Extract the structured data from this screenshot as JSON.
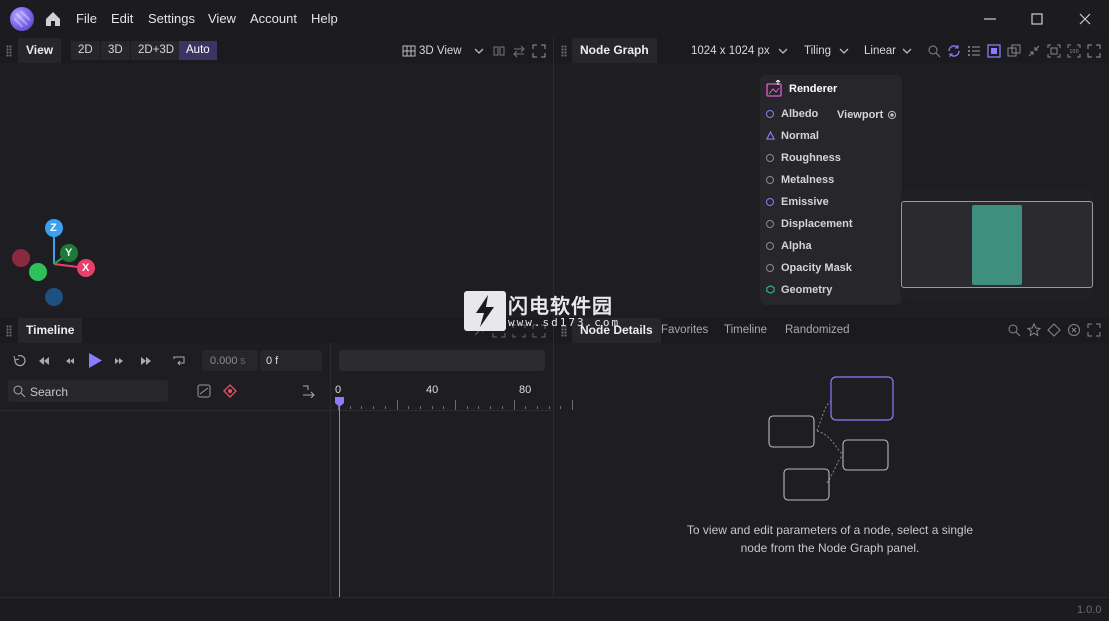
{
  "menu": {
    "items": [
      "File",
      "Edit",
      "Settings",
      "View",
      "Account",
      "Help"
    ]
  },
  "view_panel": {
    "tab": "View",
    "modes": [
      "2D",
      "3D",
      "2D+3D",
      "Auto"
    ],
    "active_mode": "Auto",
    "view_select": "3D View",
    "axes": {
      "x": "X",
      "y": "Y",
      "z": "Z"
    }
  },
  "node_graph": {
    "tab": "Node Graph",
    "resolution": "1024 x 1024 px",
    "tiling": "Tiling",
    "interp": "Linear",
    "node": {
      "title": "Renderer",
      "viewport_label": "Viewport",
      "inputs": [
        "Albedo",
        "Normal",
        "Roughness",
        "Metalness",
        "Emissive",
        "Displacement",
        "Alpha",
        "Opacity Mask",
        "Geometry"
      ]
    }
  },
  "timeline": {
    "tab": "Timeline",
    "time_value": "0.000",
    "time_unit": "s",
    "frame_value": "0 f",
    "search_placeholder": "Search",
    "ruler": [
      "0",
      "40",
      "80"
    ]
  },
  "details": {
    "tabs": [
      "Node Details",
      "Favorites",
      "Timeline",
      "Randomized"
    ],
    "active_tab": "Node Details",
    "empty_line1": "To view and edit parameters of a node, select a single",
    "empty_line2": "node from the Node Graph panel."
  },
  "watermark": {
    "text": "闪电软件园",
    "url": "www.sd173.com"
  },
  "status": {
    "version": "1.0.0"
  },
  "colors": {
    "accent": "#7f6bef",
    "axis_x": "#e8406a",
    "axis_y": "#2ec05a",
    "axis_z": "#3aa0f0",
    "preview_fill": "#3f8f7f"
  }
}
